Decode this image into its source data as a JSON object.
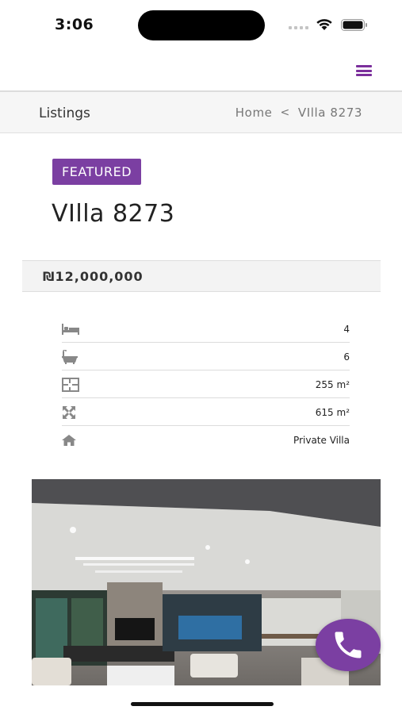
{
  "status_bar": {
    "time": "3:06"
  },
  "header": {
    "menu_icon": "hamburger-icon",
    "accent_color": "#7b2f9c"
  },
  "breadcrumb": {
    "section_title": "Listings",
    "home_label": "Home",
    "separator": "<",
    "current_label": "VIlla 8273"
  },
  "listing": {
    "badge": "FEATURED",
    "title": "VIlla 8273",
    "price": "₪12,000,000",
    "badge_color": "#7b3fa2"
  },
  "details": [
    {
      "icon": "bed-icon",
      "value": "4"
    },
    {
      "icon": "bath-icon",
      "value": "6"
    },
    {
      "icon": "floor-plan-icon",
      "value": "255 m²"
    },
    {
      "icon": "expand-arrows-icon",
      "value": "615 m²"
    },
    {
      "icon": "home-icon",
      "value": "Private Villa"
    }
  ],
  "photo": {
    "subject": "living-room-photo"
  },
  "fab": {
    "icon": "phone-icon"
  }
}
